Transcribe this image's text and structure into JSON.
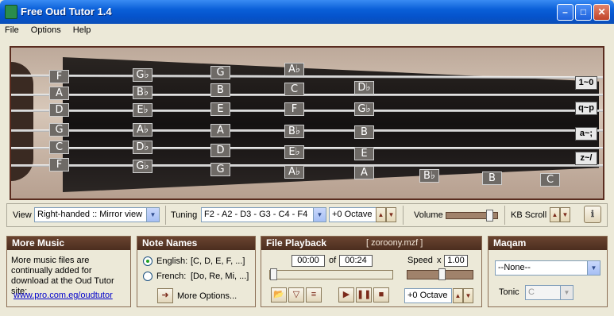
{
  "window": {
    "title": "Free Oud Tutor 1.4",
    "minimize": "–",
    "maximize": "□",
    "close": "✕"
  },
  "menu": [
    "File",
    "Options",
    "Help"
  ],
  "neck": {
    "open_notes": [
      "F",
      "A",
      "D",
      "G",
      "C",
      "F"
    ],
    "fret2": [
      "G♭",
      "B♭",
      "E♭",
      "A♭",
      "D♭",
      "G♭"
    ],
    "fret3": [
      "G",
      "B",
      "E",
      "A",
      "D",
      "G"
    ],
    "fret4": [
      "A♭",
      "C",
      "F",
      "B♭",
      "E♭",
      "A♭"
    ],
    "fret5": [
      "D♭",
      "G♭",
      "B",
      "E",
      "A"
    ],
    "extra": [
      "B♭",
      "B",
      "C"
    ],
    "key_labels": [
      "1~0",
      "q~p",
      "a~;",
      "z~/"
    ]
  },
  "controls": {
    "view_label": "View",
    "view_value": "Right-handed :: Mirror view",
    "tuning_label": "Tuning",
    "tuning_value": "F2 - A2 - D3 - G3 - C4 - F4",
    "octave_value": "+0 Octave",
    "volume_label": "Volume",
    "volume_level": 0.9,
    "kbscroll_label": "KB Scroll"
  },
  "more_music": {
    "title": "More Music",
    "text": "More music files are continually added for download at the Oud Tutor site:",
    "link": "www.pro.com.eg/oudtutor"
  },
  "note_names": {
    "title": "Note Names",
    "english_label": "English:",
    "english_values": "[C, D, E, F, ...]",
    "french_label": "French:",
    "french_values": "[Do, Re, Mi, ...]",
    "more_options": "More Options..."
  },
  "playback": {
    "title": "File Playback",
    "filename": "[ zoroony.mzf ]",
    "current_time": "00:00",
    "of_label": "of",
    "total_time": "00:24",
    "speed_label": "Speed",
    "speed_x": "x",
    "speed_value": "1.00",
    "octave_value": "+0 Octave"
  },
  "maqam": {
    "title": "Maqam",
    "value": "--None--",
    "tonic_label": "Tonic",
    "tonic_value": "C"
  }
}
